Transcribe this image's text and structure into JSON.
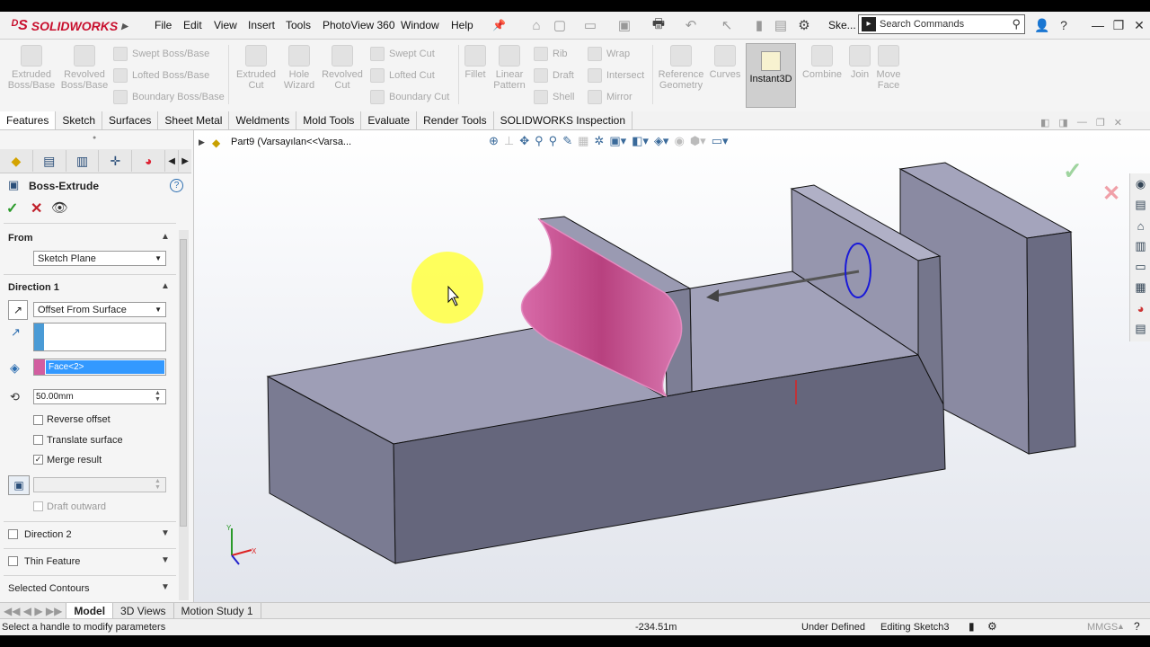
{
  "app": {
    "logo": "SOLIDWORKS",
    "doc_title_short": "Ske..."
  },
  "menu": [
    "File",
    "Edit",
    "View",
    "Insert",
    "Tools",
    "PhotoView 360",
    "Window",
    "Help"
  ],
  "search": {
    "placeholder": "Search Commands"
  },
  "ribbon": {
    "extruded_boss": "Extruded\nBoss/Base",
    "revolved_boss": "Revolved\nBoss/Base",
    "swept_boss": "Swept Boss/Base",
    "lofted_boss": "Lofted Boss/Base",
    "boundary_boss": "Boundary Boss/Base",
    "extruded_cut": "Extruded\nCut",
    "hole_wizard": "Hole\nWizard",
    "revolved_cut": "Revolved\nCut",
    "swept_cut": "Swept Cut",
    "lofted_cut": "Lofted Cut",
    "boundary_cut": "Boundary Cut",
    "fillet": "Fillet",
    "linear_pattern": "Linear\nPattern",
    "rib": "Rib",
    "draft": "Draft",
    "shell": "Shell",
    "wrap": "Wrap",
    "intersect": "Intersect",
    "mirror": "Mirror",
    "reference_geometry": "Reference\nGeometry",
    "curves": "Curves",
    "instant3d": "Instant3D",
    "combine": "Combine",
    "join": "Join",
    "move_face": "Move\nFace"
  },
  "tabs": [
    "Features",
    "Sketch",
    "Surfaces",
    "Sheet Metal",
    "Weldments",
    "Mold Tools",
    "Evaluate",
    "Render Tools",
    "SOLIDWORKS Inspection"
  ],
  "feature": {
    "title": "Boss-Extrude",
    "from_label": "From",
    "from_value": "Sketch Plane",
    "direction1_label": "Direction 1",
    "direction1_value": "Offset From Surface",
    "face_value": "Face<2>",
    "offset_value": "50.00mm",
    "reverse_offset": "Reverse offset",
    "translate_surface": "Translate surface",
    "merge_result": "Merge result",
    "draft_outward": "Draft outward",
    "direction2_label": "Direction 2",
    "thin_feature_label": "Thin Feature",
    "selected_contours_label": "Selected Contours"
  },
  "tree": {
    "root": "Part9  (Varsayılan<<Varsa..."
  },
  "bottom_tabs": [
    "Model",
    "3D Views",
    "Motion Study 1"
  ],
  "status": {
    "hint": "Select a handle to modify parameters",
    "coord": "-234.51m",
    "definition": "Under Defined",
    "editing": "Editing Sketch3",
    "units": "MMGS"
  },
  "colors": {
    "face_highlight": "#c8508f",
    "body": "#6e6f86",
    "top_face": "#9c9cb4",
    "confirm": "#7cc47c"
  }
}
